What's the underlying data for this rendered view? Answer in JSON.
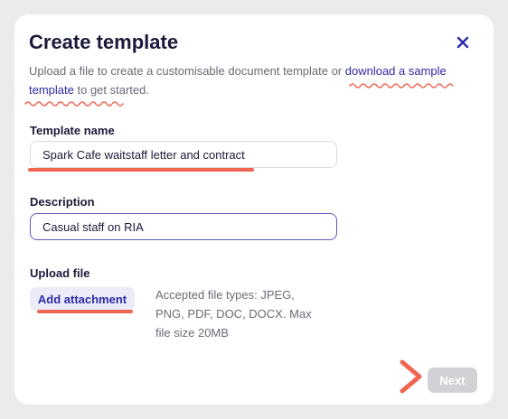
{
  "dialog": {
    "title": "Create template",
    "intro_prefix": "Upload a file to create a customisable document template or ",
    "intro_link": "download a sample template",
    "intro_suffix": " to get started."
  },
  "template_name": {
    "label": "Template name",
    "value": "Spark Cafe waitstaff letter and contract"
  },
  "description": {
    "label": "Description",
    "value": "Casual staff on RIA"
  },
  "upload": {
    "label": "Upload file",
    "button_label": "Add attachment",
    "accepted_text": "Accepted file types: JPEG, PNG, PDF, DOC, DOCX. Max file size 20MB"
  },
  "footer": {
    "next_label": "Next"
  },
  "colors": {
    "accent": "#2d2aa8",
    "annotation": "#f06452",
    "disabled": "#d2d2d6"
  },
  "icons": {
    "close": "close-icon",
    "annotation_arrow": "chevron-right-icon"
  }
}
